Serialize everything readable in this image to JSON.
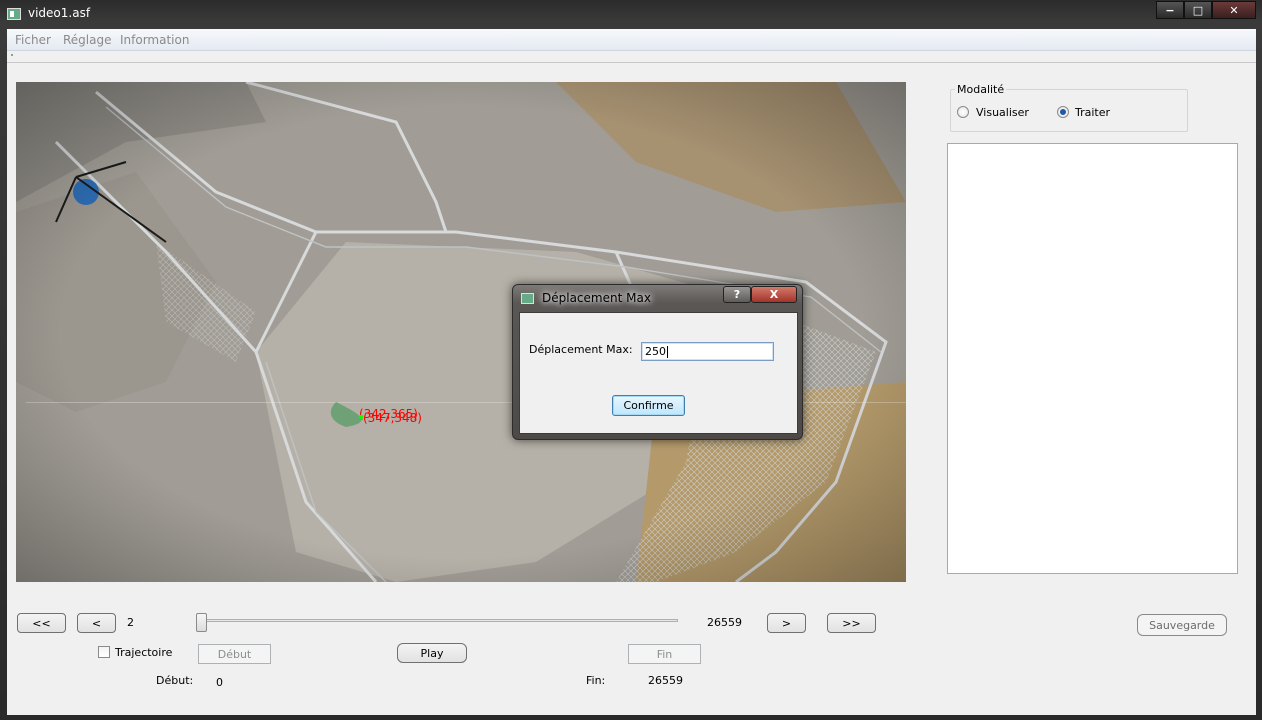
{
  "window": {
    "title": "video1.asf"
  },
  "menu": {
    "items": [
      "Ficher",
      "Réglage",
      "Information"
    ]
  },
  "video": {
    "overlay_labels": [
      "(342,365)",
      "(347,348)"
    ]
  },
  "modality": {
    "title": "Modalité",
    "options": [
      {
        "label": "Visualiser",
        "checked": false
      },
      {
        "label": "Traiter",
        "checked": true
      }
    ]
  },
  "controls": {
    "first_label": "<<",
    "prev_label": "<",
    "next_label": ">",
    "last_label": ">>",
    "current_frame": "2",
    "total_frames": "26559",
    "slider_fraction": 0.0,
    "trajectoire_label": "Trajectoire",
    "trajectoire_checked": false,
    "debut_button": "Début",
    "play_button": "Play",
    "fin_button": "Fin",
    "debut_label": "Début:",
    "debut_value": "0",
    "fin_label": "Fin:",
    "fin_value": "26559",
    "save_button": "Sauvegarde"
  },
  "dialog": {
    "title": "Déplacement Max",
    "help_label": "?",
    "close_label": "X",
    "field_label": "Déplacement Max:",
    "field_value": "250",
    "confirm_label": "Confirme"
  },
  "colors": {
    "accent": "#1d5aa8",
    "overlay": "#ff0000"
  }
}
